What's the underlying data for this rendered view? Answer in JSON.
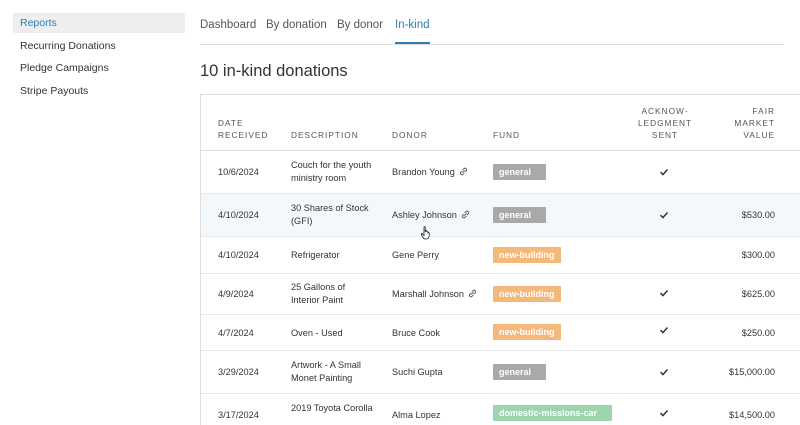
{
  "sidebar": {
    "items": [
      {
        "label": "Reports",
        "active": true
      },
      {
        "label": "Recurring Donations",
        "active": false
      },
      {
        "label": "Pledge Campaigns",
        "active": false
      },
      {
        "label": "Stripe Payouts",
        "active": false
      }
    ]
  },
  "tabs": [
    {
      "label": "Dashboard",
      "active": false
    },
    {
      "label": "By donation",
      "active": false
    },
    {
      "label": "By donor",
      "active": false
    },
    {
      "label": "In-kind",
      "active": true
    }
  ],
  "heading": "10 in-kind donations",
  "table": {
    "headers": {
      "date_l1": "DATE",
      "date_l2": "RECEIVED",
      "description": "DESCRIPTION",
      "donor": "DONOR",
      "fund": "FUND",
      "ack_l1": "ACKNOW-",
      "ack_l2": "LEDGMENT",
      "ack_l3": "SENT",
      "fmv_l1": "FAIR",
      "fmv_l2": "MARKET",
      "fmv_l3": "VALUE"
    },
    "rows": [
      {
        "date": "10/6/2024",
        "desc_l1": "Couch for the youth",
        "desc_l2": "ministry room",
        "donor": "Brandon Young",
        "linked": true,
        "fund": "general",
        "ack": true,
        "value": ""
      },
      {
        "date": "4/10/2024",
        "desc_l1": "30 Shares of Stock",
        "desc_l2": "(GFI)",
        "donor": "Ashley Johnson",
        "linked": true,
        "fund": "general",
        "ack": true,
        "value": "$530.00"
      },
      {
        "date": "4/10/2024",
        "desc_l1": "Refrigerator",
        "desc_l2": "",
        "donor": "Gene Perry",
        "linked": false,
        "fund": "new-building",
        "ack": false,
        "value": "$300.00"
      },
      {
        "date": "4/9/2024",
        "desc_l1": "25 Gallons of",
        "desc_l2": "Interior Paint",
        "donor": "Marshall Johnson",
        "linked": true,
        "fund": "new-building",
        "ack": true,
        "value": "$625.00"
      },
      {
        "date": "4/7/2024",
        "desc_l1": "Oven - Used",
        "desc_l2": "",
        "donor": "Bruce Cook",
        "linked": false,
        "fund": "new-building",
        "ack": true,
        "value": "$250.00"
      },
      {
        "date": "3/29/2024",
        "desc_l1": "Artwork - A Small",
        "desc_l2": "Monet Painting",
        "donor": "Suchi Gupta",
        "linked": false,
        "fund": "general",
        "ack": true,
        "value": "$15,000.00"
      },
      {
        "date": "3/17/2024",
        "desc_l1": "2019 Toyota Corolla",
        "desc_l2": "",
        "donor": "Alma Lopez",
        "linked": false,
        "fund": "domestic-missions-car",
        "ack": true,
        "value": "$14,500.00"
      }
    ]
  },
  "colors": {
    "accent": "#2a7fb8",
    "fund_general": "#a9a9a9",
    "fund_new_building": "#f5b87a",
    "fund_domestic": "#9cd4ad"
  }
}
